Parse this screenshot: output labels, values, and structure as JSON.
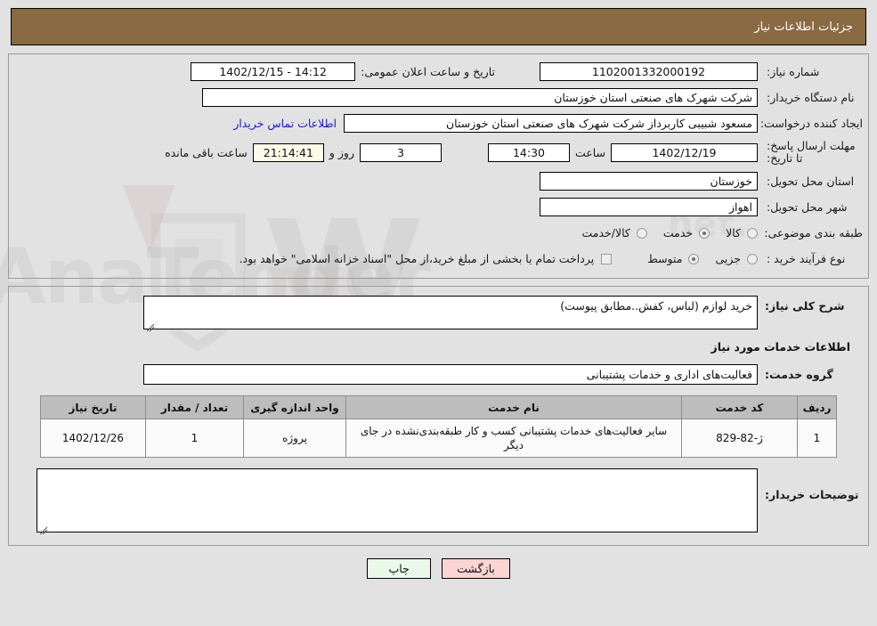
{
  "header": {
    "title": "جزئیات اطلاعات نیاز"
  },
  "top_section": {
    "need_number_label": "شماره نیاز:",
    "need_number_value": "1102001332000192",
    "public_announce_label": "تاریخ و ساعت اعلان عمومی:",
    "public_announce_value": "14:12 - 1402/12/15",
    "buyer_org_label": "نام دستگاه خریدار:",
    "buyer_org_value": "شرکت شهرک های صنعتی استان خوزستان",
    "requester_label": "ایجاد کننده درخواست:",
    "requester_value": "مسعود شبیبی کاربرداز شرکت شهرک های صنعتی استان خوزستان",
    "contact_link": "اطلاعات تماس خریدار",
    "deadline_label": "مهلت ارسال پاسخ: تا تاریخ:",
    "deadline_date": "1402/12/19",
    "hour_label": "ساعت",
    "deadline_time": "14:30",
    "days_remaining": "3",
    "days_and_label": "روز و",
    "timer_value": "21:14:41",
    "hours_remaining_label": "ساعت باقی مانده",
    "province_label": "استان محل تحویل:",
    "province_value": "خوزستان",
    "city_label": "شهر محل تحویل:",
    "city_value": "اهواز",
    "category_label": "طبقه بندی موضوعی:",
    "category_options": [
      {
        "label": "کالا",
        "selected": false
      },
      {
        "label": "خدمت",
        "selected": true
      },
      {
        "label": "کالا/خدمت",
        "selected": false
      }
    ],
    "process_label": "نوع فرآیند خرید :",
    "process_options": [
      {
        "label": "جزیی",
        "selected": false
      },
      {
        "label": "متوسط",
        "selected": true
      }
    ],
    "treasury_note": "پرداخت تمام یا بخشی از مبلغ خرید،از محل \"اسناد خزانه اسلامی\" خواهد بود.",
    "treasury_checked": false
  },
  "middle_section": {
    "general_desc_label": "شرح کلی نیاز:",
    "general_desc_value": "خرید لوازم (لباس، کفش..مطابق پیوست)",
    "services_info_title": "اطلاعات خدمات مورد نیاز",
    "service_group_label": "گروه خدمت:",
    "service_group_value": "فعالیت‌های اداری و خدمات پشتیبانی"
  },
  "table": {
    "headers": [
      "ردیف",
      "کد خدمت",
      "نام خدمت",
      "واحد اندازه گیری",
      "تعداد / مقدار",
      "تاریخ نیاز"
    ],
    "rows": [
      {
        "radif": "1",
        "code": "ژ-82-829",
        "name": "سایر فعالیت‌های خدمات پشتیبانی کسب و کار طبقه‌بندی‌نشده در جای دیگر",
        "unit": "پروژه",
        "qty": "1",
        "date": "1402/12/26"
      }
    ]
  },
  "buyer_notes": {
    "label": "توضیحات خریدار:",
    "value": "",
    "placeholder": ""
  },
  "footer": {
    "print_label": "چاپ",
    "back_label": "بازگشت"
  },
  "watermark": {
    "text": "AnaTender.net"
  },
  "colors": {
    "header_bg": "#8a6a42",
    "page_bg": "#e2e2e2",
    "link": "#1a1ad0",
    "table_header_bg": "#bdbdbd",
    "back_btn_bg": "#fbd4d4",
    "print_btn_bg": "#eaf8ea",
    "timer_bg": "#fbfbe8"
  }
}
